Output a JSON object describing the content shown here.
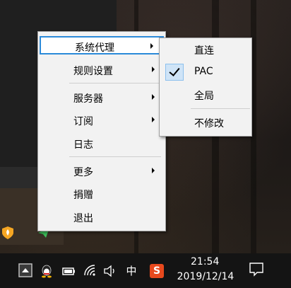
{
  "menu": {
    "items": [
      {
        "label": "系统代理",
        "submenu": true
      },
      {
        "label": "规则设置",
        "submenu": true
      },
      {
        "label": "服务器",
        "submenu": true
      },
      {
        "label": "订阅",
        "submenu": true
      },
      {
        "label": "日志",
        "submenu": false
      },
      {
        "label": "更多",
        "submenu": true
      },
      {
        "label": "捐赠",
        "submenu": false
      },
      {
        "label": "退出",
        "submenu": false
      }
    ]
  },
  "submenu": {
    "items": [
      {
        "label": "直连",
        "checked": false
      },
      {
        "label": "PAC",
        "checked": true
      },
      {
        "label": "全局",
        "checked": false
      },
      {
        "label": "不修改",
        "checked": false
      }
    ]
  },
  "taskbar": {
    "ime_label": "中",
    "sogou_label": "S",
    "time": "21:54",
    "date": "2019/12/14"
  },
  "colors": {
    "menu_bg": "#f2f2f2",
    "highlight_border": "#2b8ad9",
    "check_bg": "#cfe4f7",
    "taskbar_bg": "#141414"
  }
}
